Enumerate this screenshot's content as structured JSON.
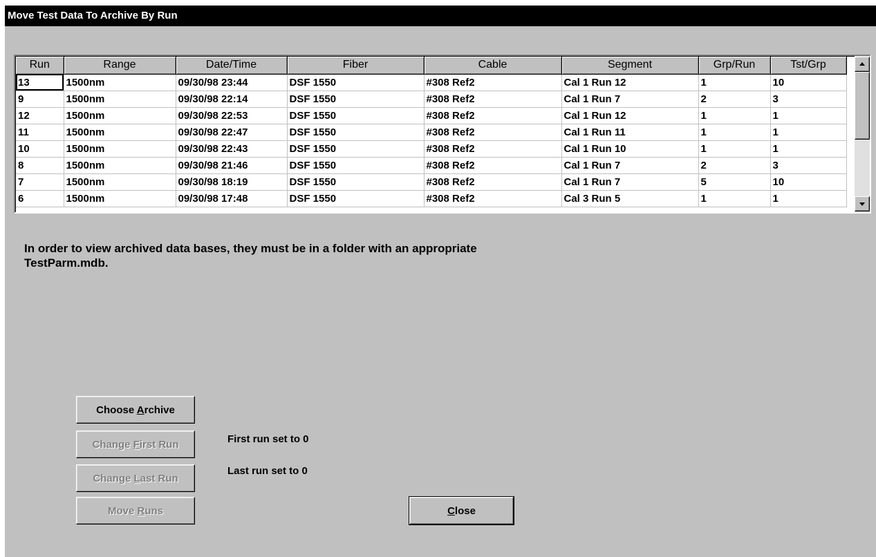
{
  "window": {
    "title": "Move Test Data To Archive By Run"
  },
  "grid": {
    "columns": [
      "Run",
      "Range",
      "Date/Time",
      "Fiber",
      "Cable",
      "Segment",
      "Grp/Run",
      "Tst/Grp"
    ],
    "rows": [
      [
        "13",
        "1500nm",
        "09/30/98 23:44",
        "DSF 1550",
        "#308 Ref2",
        "Cal 1 Run 12",
        "1",
        "10"
      ],
      [
        "9",
        "1500nm",
        "09/30/98 22:14",
        "DSF 1550",
        "#308 Ref2",
        "Cal 1 Run 7",
        "2",
        "3"
      ],
      [
        "12",
        "1500nm",
        "09/30/98 22:53",
        "DSF 1550",
        "#308 Ref2",
        "Cal 1 Run 12",
        "1",
        "1"
      ],
      [
        "11",
        "1500nm",
        "09/30/98 22:47",
        "DSF 1550",
        "#308 Ref2",
        "Cal 1 Run 11",
        "1",
        "1"
      ],
      [
        "10",
        "1500nm",
        "09/30/98 22:43",
        "DSF 1550",
        "#308 Ref2",
        "Cal 1 Run 10",
        "1",
        "1"
      ],
      [
        "8",
        "1500nm",
        "09/30/98 21:46",
        "DSF 1550",
        "#308 Ref2",
        "Cal 1 Run 7",
        "2",
        "3"
      ],
      [
        "7",
        "1500nm",
        "09/30/98 18:19",
        "DSF 1550",
        "#308 Ref2",
        "Cal 1 Run 7",
        "5",
        "10"
      ],
      [
        "6",
        "1500nm",
        "09/30/98 17:48",
        "DSF 1550",
        "#308 Ref2",
        "Cal 3 Run 5",
        "1",
        "1"
      ]
    ]
  },
  "info": {
    "line1": "In order to view archived data bases, they must be in a folder with an appropriate",
    "line2": "TestParm.mdb."
  },
  "buttons": {
    "choose_archive": {
      "before": "Choose ",
      "accel": "A",
      "after": "rchive",
      "enabled": true
    },
    "change_first_run": {
      "before": "Change ",
      "accel": "F",
      "after": "irst Run",
      "enabled": false
    },
    "change_last_run": {
      "before": "Change ",
      "accel": "L",
      "after": "ast Run",
      "enabled": false
    },
    "move_runs": {
      "before": "Move ",
      "accel": "R",
      "after": "uns",
      "enabled": false
    },
    "close": {
      "before": "",
      "accel": "C",
      "after": "lose",
      "enabled": true
    }
  },
  "status": {
    "first_run": "First run set to 0",
    "last_run": "Last run set to 0"
  },
  "icons": {
    "scroll_up": "scroll-up-arrow-icon",
    "scroll_down": "scroll-down-arrow-icon"
  }
}
